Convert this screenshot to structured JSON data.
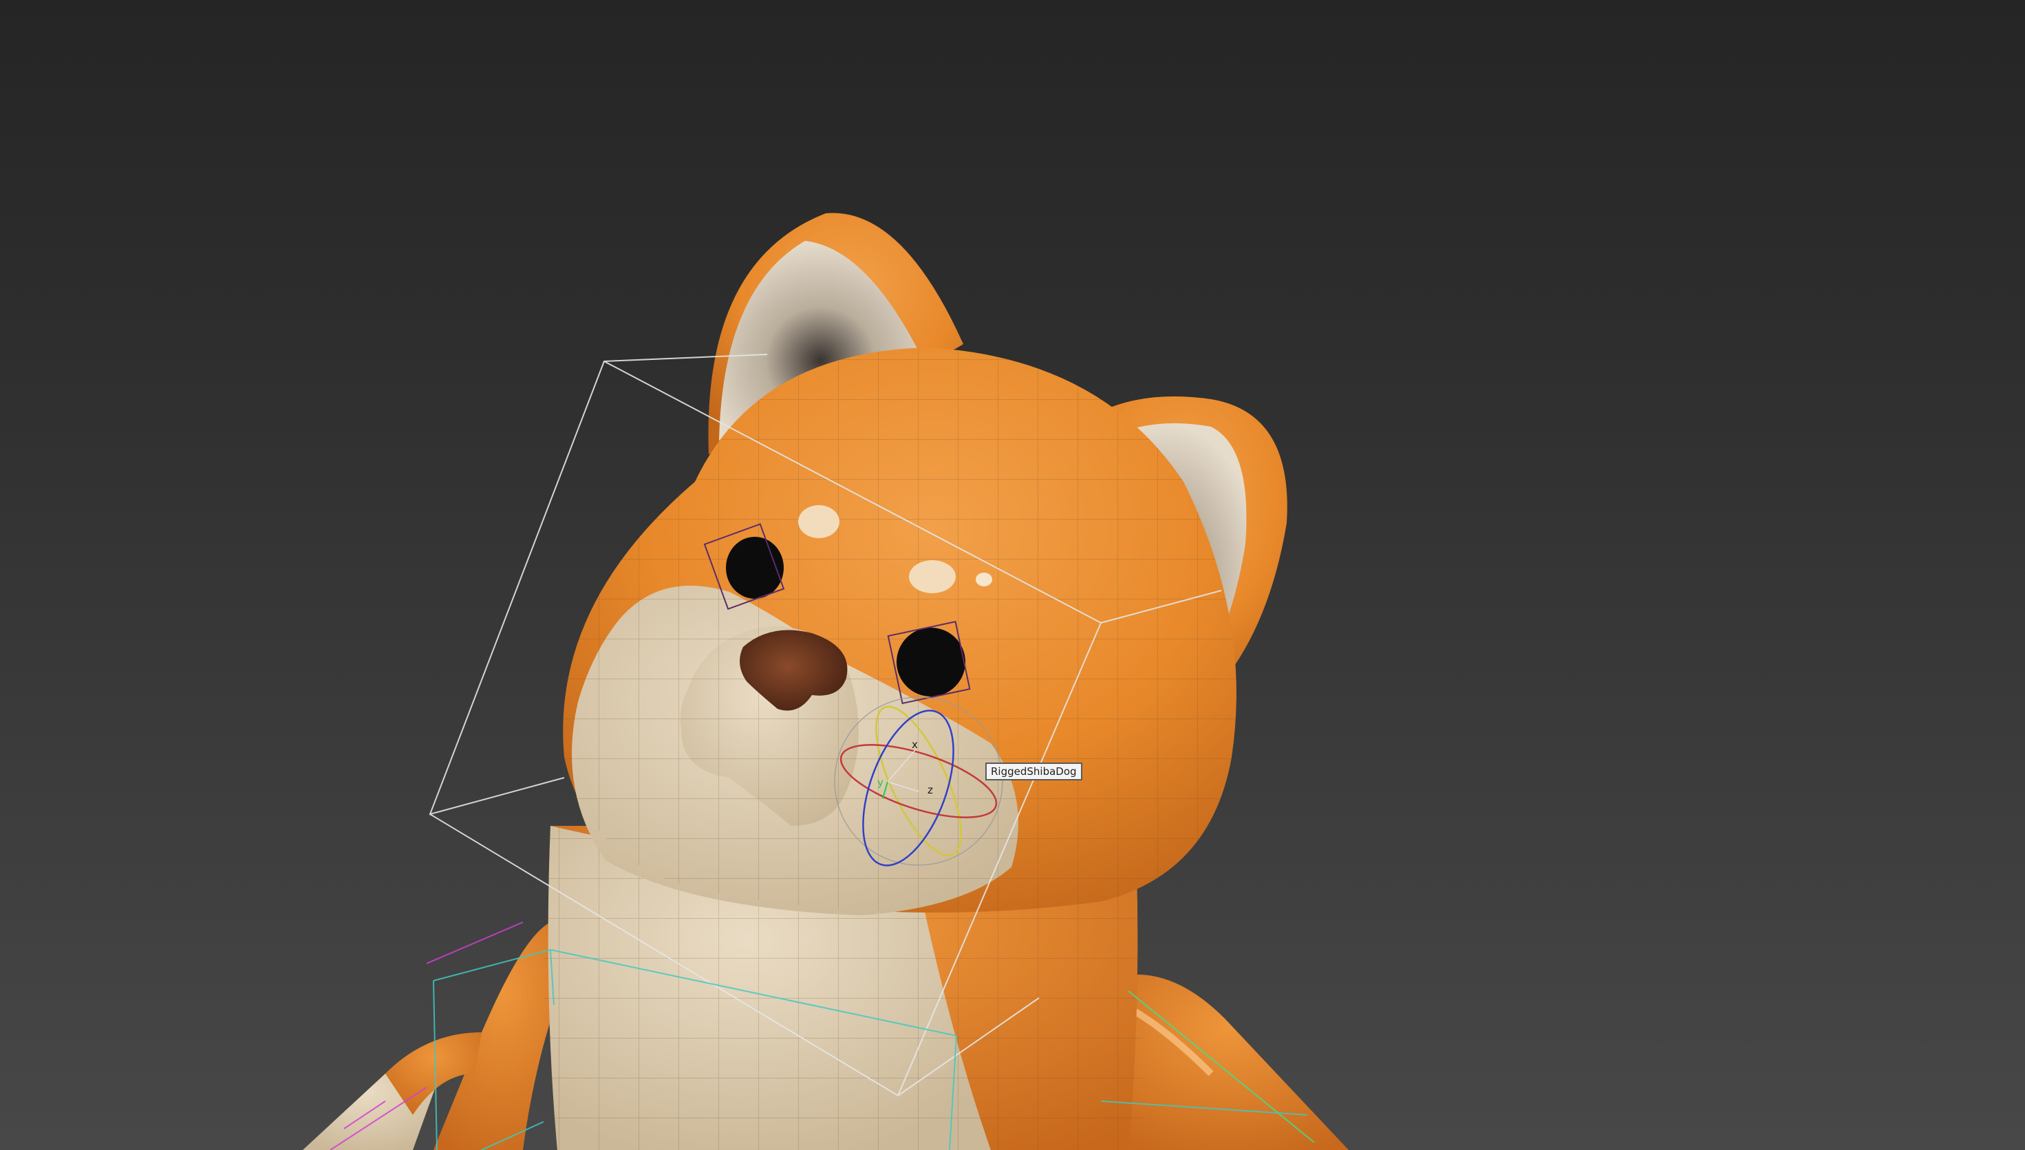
{
  "viewport": {
    "background_top": "#252525",
    "background_bottom": "#484848"
  },
  "model": {
    "name": "RiggedShibaDog",
    "fur_color": "#e8892b",
    "cream_color": "#dccbb0",
    "nose_color": "#6b3a22",
    "eye_color": "#0c0c0c"
  },
  "tooltip": {
    "text": "RiggedShibaDog"
  },
  "gizmo": {
    "axis_x": "x",
    "axis_y": "y",
    "axis_z": "z"
  }
}
